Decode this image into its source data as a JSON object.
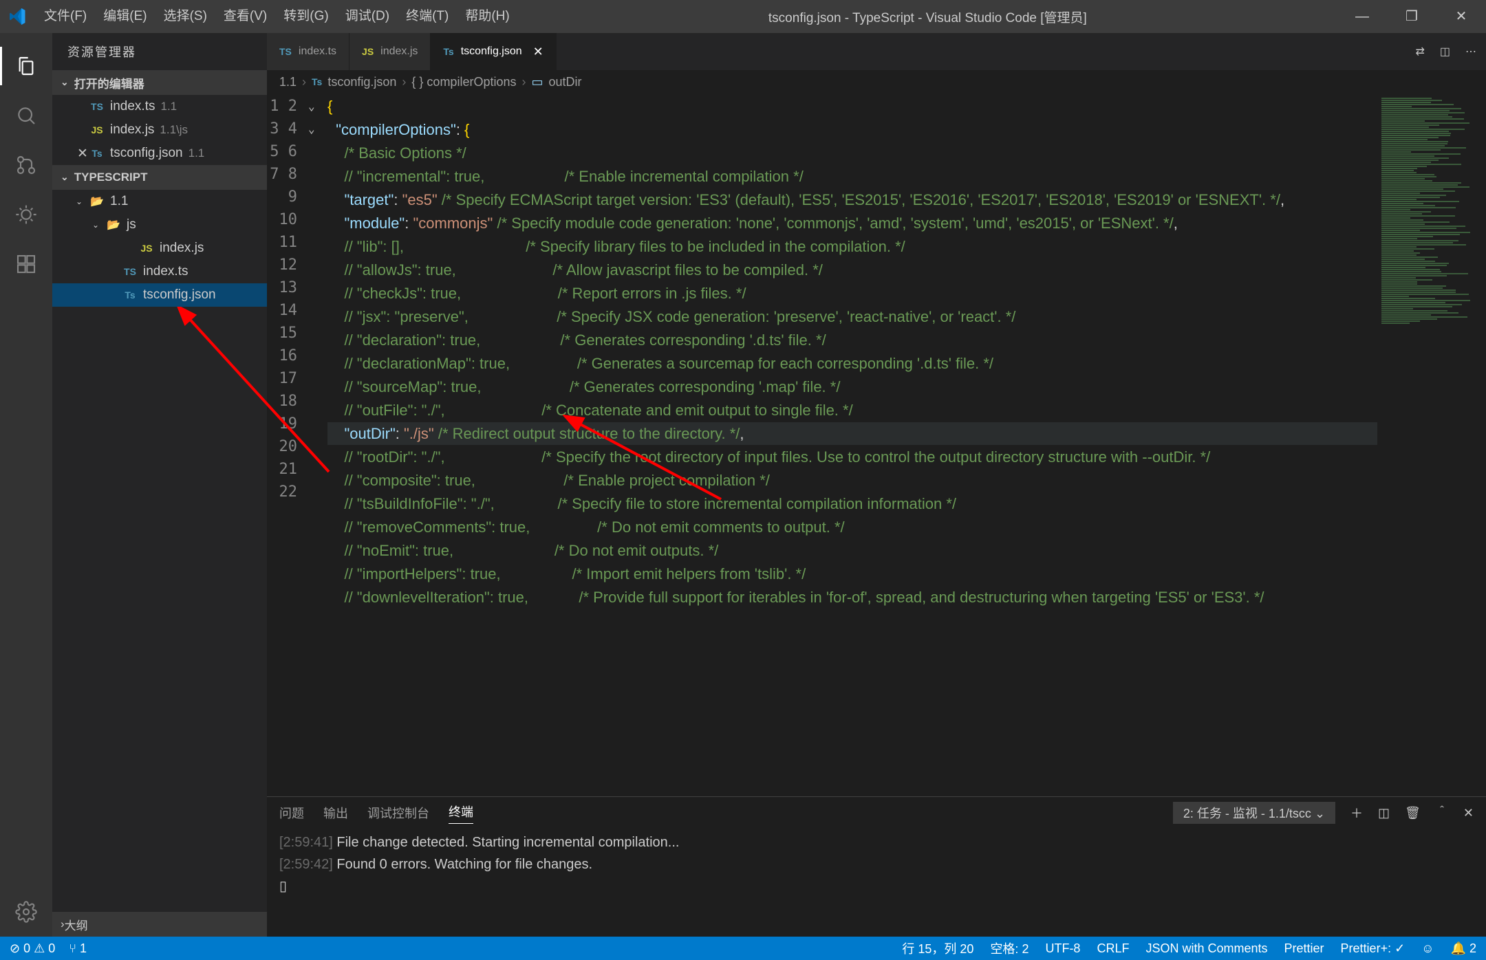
{
  "titlebar": {
    "menus": [
      "文件(F)",
      "编辑(E)",
      "选择(S)",
      "查看(V)",
      "转到(G)",
      "调试(D)",
      "终端(T)",
      "帮助(H)"
    ],
    "title": "tsconfig.json - TypeScript - Visual Studio Code [管理员]"
  },
  "sidebar": {
    "header": "资源管理器",
    "sections": {
      "openEditors": "打开的编辑器",
      "workspace": "TYPESCRIPT",
      "outline": "大纲"
    },
    "openEditors": [
      {
        "icon": "ts",
        "name": "index.ts",
        "meta": "1.1"
      },
      {
        "icon": "js",
        "name": "index.js",
        "meta": "1.1\\js"
      },
      {
        "icon": "json",
        "name": "tsconfig.json",
        "meta": "1.1",
        "close": true
      }
    ],
    "tree": {
      "folder1": "1.1",
      "folder2": "js",
      "files": [
        {
          "icon": "js",
          "name": "index.js"
        },
        {
          "icon": "ts",
          "name": "index.ts"
        },
        {
          "icon": "json",
          "name": "tsconfig.json",
          "selected": true
        }
      ]
    }
  },
  "tabs": [
    {
      "icon": "ts",
      "label": "index.ts",
      "active": false
    },
    {
      "icon": "js",
      "label": "index.js",
      "active": false
    },
    {
      "icon": "json",
      "label": "tsconfig.json",
      "active": true
    }
  ],
  "breadcrumbs": [
    "1.1",
    "tsconfig.json",
    "{ } compilerOptions",
    "outDir"
  ],
  "code": {
    "lines": [
      {
        "n": 1,
        "fold": "v",
        "ind": 0,
        "segs": [
          [
            "brace",
            "{"
          ]
        ]
      },
      {
        "n": 2,
        "fold": "v",
        "ind": 1,
        "segs": [
          [
            "key",
            "\"compilerOptions\""
          ],
          [
            "punc",
            ": "
          ],
          [
            "brace",
            "{"
          ]
        ]
      },
      {
        "n": 3,
        "fold": "",
        "ind": 2,
        "segs": [
          [
            "com",
            "/* Basic Options */"
          ]
        ]
      },
      {
        "n": 4,
        "fold": "",
        "ind": 2,
        "segs": [
          [
            "com",
            "// \"incremental\": true,                   /* Enable incremental compilation */"
          ]
        ]
      },
      {
        "n": 5,
        "fold": "",
        "ind": 2,
        "segs": [
          [
            "key",
            "\"target\""
          ],
          [
            "punc",
            ": "
          ],
          [
            "str",
            "\"es5\""
          ],
          [
            "com",
            " /* Specify ECMAScript target version: 'ES3' (default), 'ES5', 'ES2015', 'ES2016', 'ES2017', 'ES2018', 'ES2019' or 'ESNEXT'. */"
          ],
          [
            "punc",
            ","
          ]
        ]
      },
      {
        "n": 6,
        "fold": "",
        "ind": 2,
        "segs": [
          [
            "key",
            "\"module\""
          ],
          [
            "punc",
            ": "
          ],
          [
            "str",
            "\"commonjs\""
          ],
          [
            "com",
            " /* Specify module code generation: 'none', 'commonjs', 'amd', 'system', 'umd', 'es2015', or 'ESNext'. */"
          ],
          [
            "punc",
            ","
          ]
        ]
      },
      {
        "n": 7,
        "fold": "",
        "ind": 2,
        "segs": [
          [
            "com",
            "// \"lib\": [],                             /* Specify library files to be included in the compilation. */"
          ]
        ]
      },
      {
        "n": 8,
        "fold": "",
        "ind": 2,
        "segs": [
          [
            "com",
            "// \"allowJs\": true,                       /* Allow javascript files to be compiled. */"
          ]
        ]
      },
      {
        "n": 9,
        "fold": "",
        "ind": 2,
        "segs": [
          [
            "com",
            "// \"checkJs\": true,                       /* Report errors in .js files. */"
          ]
        ]
      },
      {
        "n": 10,
        "fold": "",
        "ind": 2,
        "segs": [
          [
            "com",
            "// \"jsx\": \"preserve\",                     /* Specify JSX code generation: 'preserve', 'react-native', or 'react'. */"
          ]
        ]
      },
      {
        "n": 11,
        "fold": "",
        "ind": 2,
        "segs": [
          [
            "com",
            "// \"declaration\": true,                   /* Generates corresponding '.d.ts' file. */"
          ]
        ]
      },
      {
        "n": 12,
        "fold": "",
        "ind": 2,
        "segs": [
          [
            "com",
            "// \"declarationMap\": true,                /* Generates a sourcemap for each corresponding '.d.ts' file. */"
          ]
        ]
      },
      {
        "n": 13,
        "fold": "",
        "ind": 2,
        "segs": [
          [
            "com",
            "// \"sourceMap\": true,                     /* Generates corresponding '.map' file. */"
          ]
        ]
      },
      {
        "n": 14,
        "fold": "",
        "ind": 2,
        "segs": [
          [
            "com",
            "// \"outFile\": \"./\",                       /* Concatenate and emit output to single file. */"
          ]
        ]
      },
      {
        "n": 15,
        "fold": "",
        "ind": 2,
        "hl": true,
        "segs": [
          [
            "key",
            "\"outDir\""
          ],
          [
            "punc",
            ": "
          ],
          [
            "str",
            "\"./js\""
          ],
          [
            "com",
            " /* Redirect output structure to the directory. */"
          ],
          [
            "punc",
            ","
          ]
        ]
      },
      {
        "n": 16,
        "fold": "",
        "ind": 2,
        "segs": [
          [
            "com",
            "// \"rootDir\": \"./\",                       /* Specify the root directory of input files. Use to control the output directory structure with --outDir. */"
          ]
        ]
      },
      {
        "n": 17,
        "fold": "",
        "ind": 2,
        "segs": [
          [
            "com",
            "// \"composite\": true,                     /* Enable project compilation */"
          ]
        ]
      },
      {
        "n": 18,
        "fold": "",
        "ind": 2,
        "segs": [
          [
            "com",
            "// \"tsBuildInfoFile\": \"./\",               /* Specify file to store incremental compilation information */"
          ]
        ]
      },
      {
        "n": 19,
        "fold": "",
        "ind": 2,
        "segs": [
          [
            "com",
            "// \"removeComments\": true,                /* Do not emit comments to output. */"
          ]
        ]
      },
      {
        "n": 20,
        "fold": "",
        "ind": 2,
        "segs": [
          [
            "com",
            "// \"noEmit\": true,                        /* Do not emit outputs. */"
          ]
        ]
      },
      {
        "n": 21,
        "fold": "",
        "ind": 2,
        "segs": [
          [
            "com",
            "// \"importHelpers\": true,                 /* Import emit helpers from 'tslib'. */"
          ]
        ]
      },
      {
        "n": 22,
        "fold": "",
        "ind": 2,
        "segs": [
          [
            "com",
            "// \"downlevelIteration\": true,            /* Provide full support for iterables in 'for-of', spread, and destructuring when targeting 'ES5' or 'ES3'. */"
          ]
        ]
      }
    ]
  },
  "panel": {
    "tabs": [
      "问题",
      "输出",
      "调试控制台",
      "终端"
    ],
    "activeTab": 3,
    "select": "2: 任务 - 监视 - 1.1/tscc",
    "lines": [
      {
        "ts": "[2:59:41]",
        "text": " File change detected. Starting incremental compilation..."
      },
      {
        "ts": "[2:59:42]",
        "text": " Found 0 errors. Watching for file changes."
      },
      {
        "ts": "",
        "text": "▯"
      }
    ]
  },
  "statusbar": {
    "errors": "⊘ 0 ⚠ 0",
    "fork": "⑂ 1",
    "right": [
      "行 15，列 20",
      "空格: 2",
      "UTF-8",
      "CRLF",
      "JSON with Comments",
      "Prettier",
      "Prettier+: ✓",
      "☺",
      "🔔 2"
    ]
  }
}
